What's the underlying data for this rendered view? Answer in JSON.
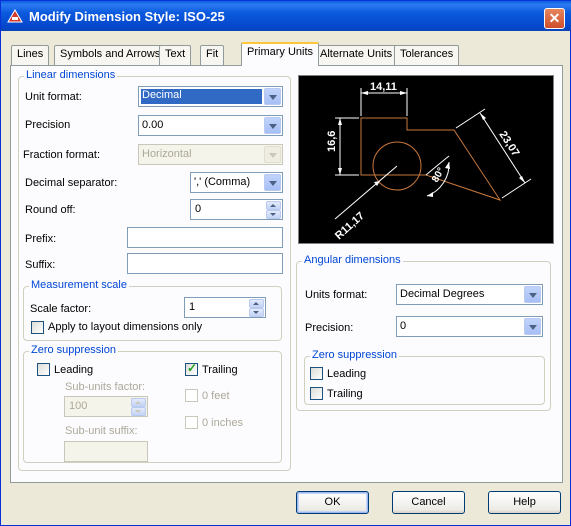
{
  "window": {
    "title": "Modify Dimension Style: ISO-25",
    "close_glyph": "✕"
  },
  "tabs": [
    "Lines",
    "Symbols and Arrows",
    "Text",
    "Fit",
    "Primary Units",
    "Alternate Units",
    "Tolerances"
  ],
  "active_tab": "Primary Units",
  "linear": {
    "group_title": "Linear dimensions",
    "unit_format_label": "Unit format:",
    "unit_format_value": "Decimal",
    "precision_label": "Precision",
    "precision_value": "0.00",
    "fraction_format_label": "Fraction format:",
    "fraction_format_value": "Horizontal",
    "decimal_separator_label": "Decimal separator:",
    "decimal_separator_value": "',' (Comma)",
    "round_off_label": "Round off:",
    "round_off_value": "0",
    "prefix_label": "Prefix:",
    "prefix_value": "",
    "suffix_label": "Suffix:",
    "suffix_value": ""
  },
  "measurement_scale": {
    "group_title": "Measurement scale",
    "scale_factor_label": "Scale factor:",
    "scale_factor_value": "1",
    "apply_layout_label": "Apply to layout dimensions only",
    "apply_layout_checked": false
  },
  "zero_suppression_linear": {
    "group_title": "Zero suppression",
    "leading_label": "Leading",
    "leading_checked": false,
    "trailing_label": "Trailing",
    "trailing_checked": true,
    "subunits_factor_label": "Sub-units factor:",
    "subunits_factor_value": "100",
    "subunit_suffix_label": "Sub-unit suffix:",
    "subunit_suffix_value": "",
    "feet_label": "0 feet",
    "inches_label": "0 inches"
  },
  "preview": {
    "dim_top": "14,11",
    "dim_left": "16,6",
    "dim_right": "23,07",
    "dim_angle": "80°",
    "dim_radius": "R11,17",
    "line_color": "#FFFFFF",
    "shape_color": "#C8783C"
  },
  "angular": {
    "group_title": "Angular dimensions",
    "units_format_label": "Units format:",
    "units_format_value": "Decimal Degrees",
    "precision_label": "Precision:",
    "precision_value": "0"
  },
  "zero_suppression_angular": {
    "group_title": "Zero suppression",
    "leading_label": "Leading",
    "leading_checked": false,
    "trailing_label": "Trailing",
    "trailing_checked": false
  },
  "buttons": {
    "ok": "OK",
    "cancel": "Cancel",
    "help": "Help"
  },
  "colors": {
    "title_bar": "#0A5FE0",
    "group_title": "#0046D5",
    "selection": "#316AC5"
  }
}
